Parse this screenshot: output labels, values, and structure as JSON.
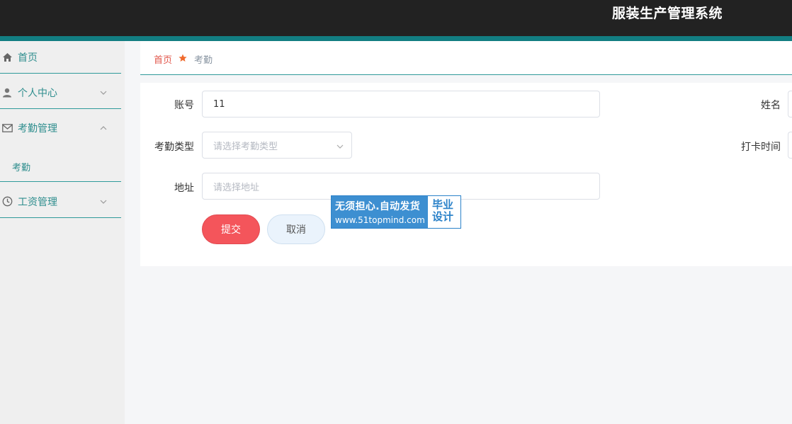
{
  "header": {
    "title": "服装生产管理系统"
  },
  "sidebar": {
    "items": [
      {
        "label": "首页",
        "icon": "home-icon"
      },
      {
        "label": "个人中心",
        "icon": "user-icon"
      },
      {
        "label": "考勤管理",
        "icon": "mail-icon"
      },
      {
        "label": "工资管理",
        "icon": "clock-icon"
      }
    ],
    "submenu": {
      "label": "考勤"
    }
  },
  "breadcrumb": {
    "home": "首页",
    "current": "考勤"
  },
  "form": {
    "account": {
      "label": "账号",
      "value": "11"
    },
    "name": {
      "label": "姓名"
    },
    "type": {
      "label": "考勤类型",
      "placeholder": "请选择考勤类型"
    },
    "punch_time": {
      "label": "打卡时间"
    },
    "address": {
      "label": "地址",
      "placeholder": "请选择地址"
    },
    "submit_label": "提交",
    "cancel_label": "取消"
  },
  "watermark": {
    "line1": "无须担心.自动发货",
    "line2": "www.51topmind.com",
    "right_top": "毕业",
    "right_bottom": "设计"
  },
  "colors": {
    "accent": "#2f9a9a",
    "header_bg": "#222222",
    "submit": "#f4555b",
    "breadcrumb_home": "#e2574c"
  }
}
